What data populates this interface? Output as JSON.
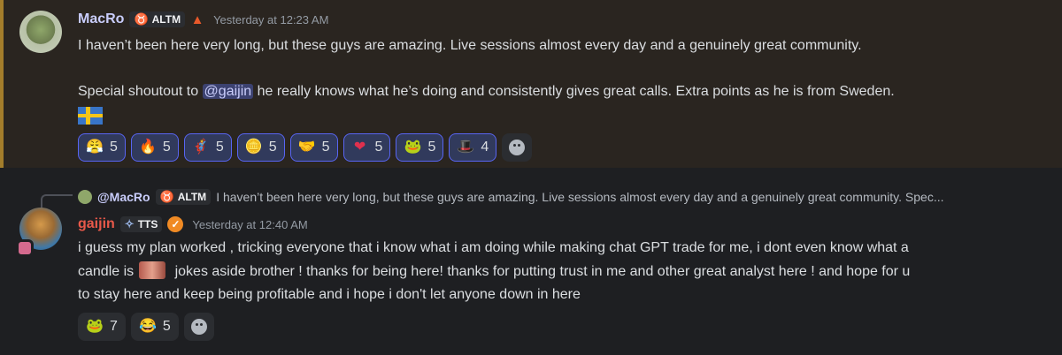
{
  "message1": {
    "author": "MacRo",
    "author_color": "#c9cdfb",
    "tag": "ALTM",
    "timestamp": "Yesterday at 12:23 AM",
    "line1": "I haven’t been here very long, but these guys are amazing. Live sessions almost every day and a genuinely great community.",
    "line2_prefix": "Special shoutout to ",
    "mention": "@gaijin",
    "line2_suffix": " he really knows what he’s doing and consistently gives great calls. Extra points as he is from Sweden.",
    "flag_icon": "sweden-flag-icon",
    "reactions": [
      {
        "icon": "custom-character-icon",
        "glyph": "😤",
        "count": "5"
      },
      {
        "icon": "fire-icon",
        "glyph": "🔥",
        "count": "5"
      },
      {
        "icon": "custom-warrior-icon",
        "glyph": "🦸",
        "count": "5"
      },
      {
        "icon": "coin-icon",
        "glyph": "🪙",
        "count": "5"
      },
      {
        "icon": "handshake-icon",
        "glyph": "🤝",
        "count": "5"
      },
      {
        "icon": "heart-icon",
        "glyph": "❤",
        "count": "5"
      },
      {
        "icon": "pepe-icon",
        "glyph": "🐸",
        "count": "5"
      },
      {
        "icon": "custom-figure-icon",
        "glyph": "🎩",
        "count": "4"
      }
    ]
  },
  "message2": {
    "reply": {
      "author": "@MacRo",
      "tag": "ALTM",
      "preview": "I haven’t been here very long, but these guys are amazing. Live sessions almost every day and a genuinely great community.  Spec..."
    },
    "author": "gaijin",
    "author_color": "#e8594a",
    "tag": "TTS",
    "timestamp": "Yesterday at 12:40 AM",
    "line1": "i guess my plan worked , tricking everyone that i know what i am doing  while making chat GPT trade for me, i dont even know what a",
    "line2_prefix": "candle is",
    "line2_suffix": " jokes aside brother ! thanks for being here! thanks for putting trust in me and other great analyst here ! and hope for u",
    "line3": "to stay here and keep being profitable and i hope i don't let anyone down in here",
    "reactions": [
      {
        "icon": "pepe-icon",
        "glyph": "🐸",
        "count": "7"
      },
      {
        "icon": "laughing-tears-icon",
        "glyph": "😂",
        "count": "5"
      }
    ]
  }
}
